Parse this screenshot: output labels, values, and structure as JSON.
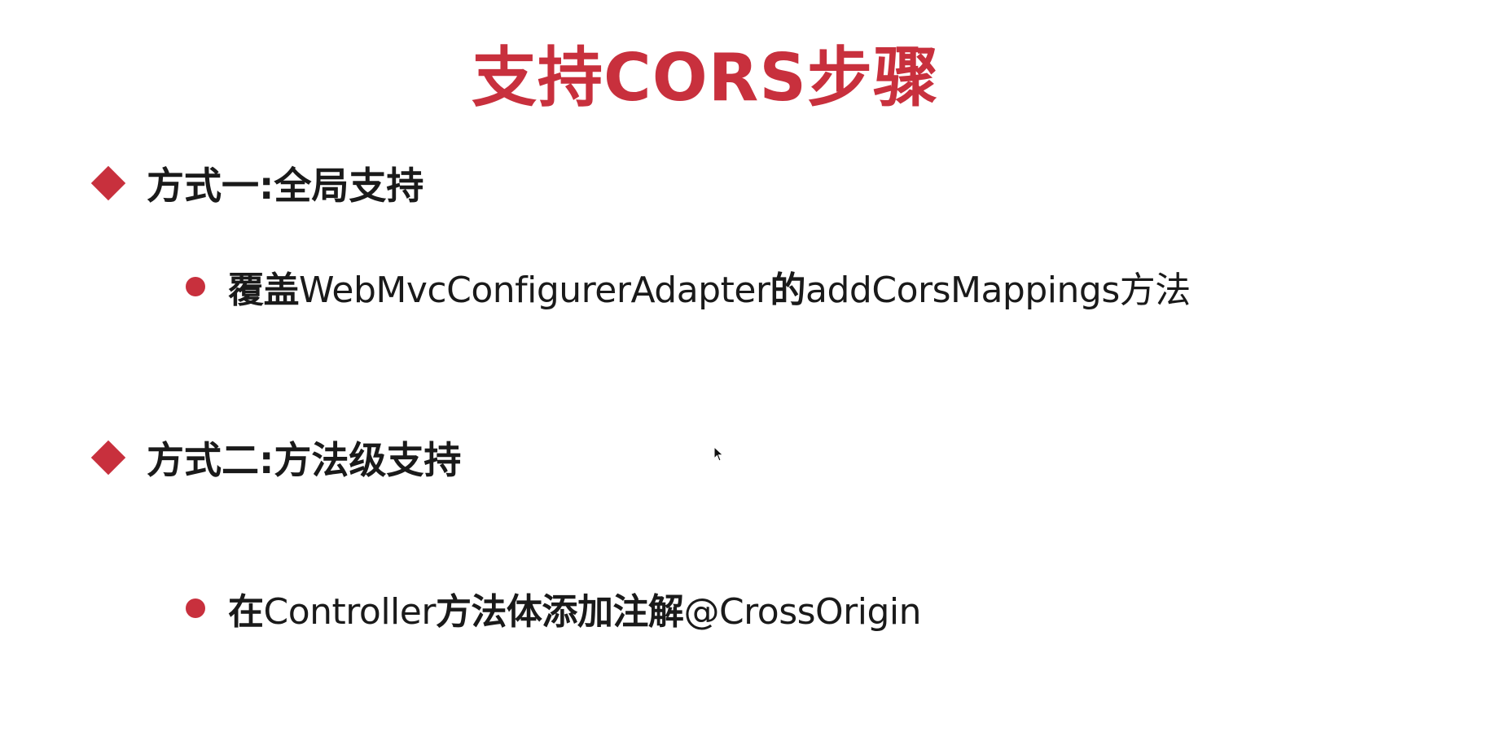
{
  "title": "支持CORS步骤",
  "sections": [
    {
      "label": "方式一:全局支持",
      "bullet": {
        "prefix": "覆盖",
        "code1": "WebMvcConfigurerAdapter",
        "mid": "的",
        "code2": "addCorsMappings",
        "suffix": "方法"
      }
    },
    {
      "label": "方式二:方法级支持",
      "bullet": {
        "prefix": "在",
        "code1": "Controller",
        "mid": "方法体添加注解",
        "code2": "@CrossOrigin"
      }
    }
  ],
  "colors": {
    "accent": "#c8303d",
    "text": "#1a1a1a",
    "background": "#ffffff"
  },
  "icons": {
    "section_marker": "diamond-icon",
    "bullet_marker": "dot-icon",
    "cursor": "mouse-cursor-icon"
  }
}
